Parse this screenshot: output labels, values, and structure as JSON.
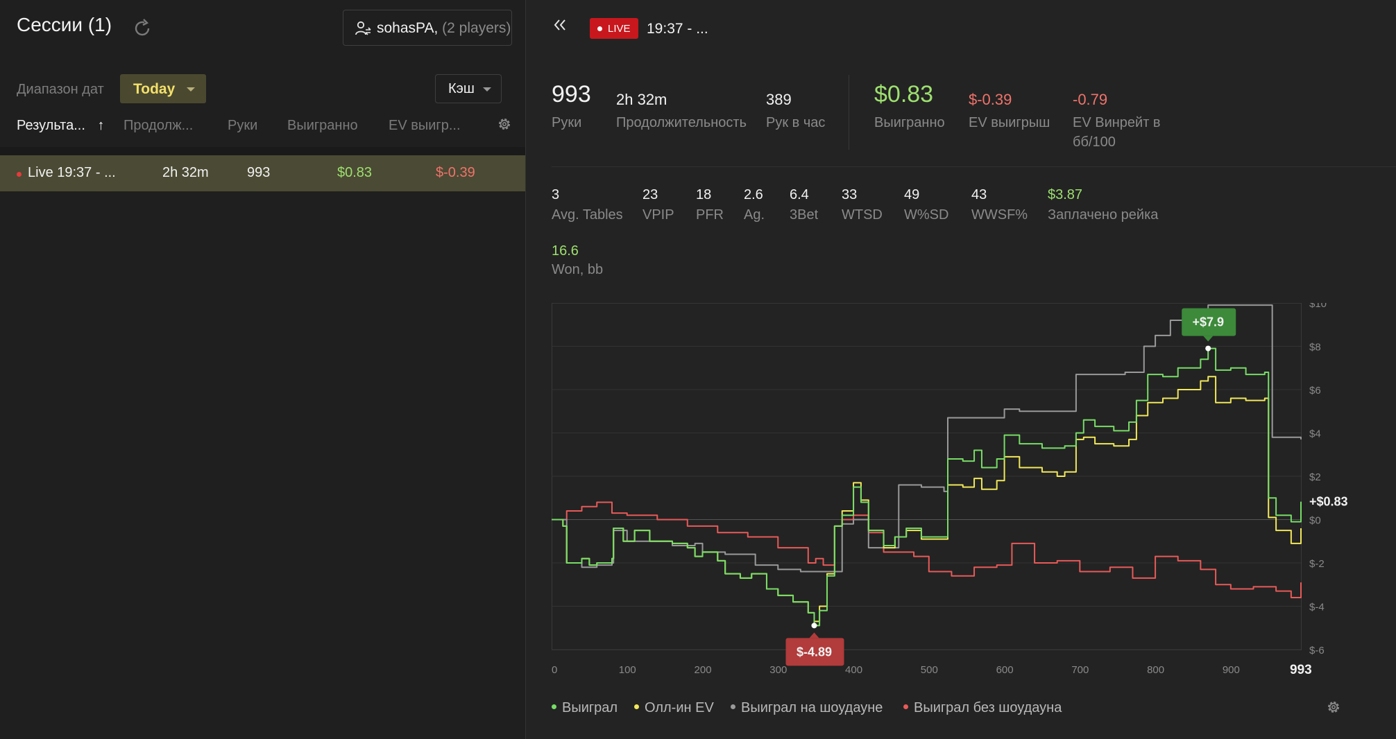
{
  "sessions": {
    "title": "Сессии (1)",
    "player_button": {
      "name": "sohasPA",
      "count": "(2 players)"
    },
    "date_range_label": "Диапазон дат",
    "date_range_value": "Today",
    "game_type": "Кэш",
    "columns": [
      "Результа...",
      "Продолж...",
      "Руки",
      "Выигранно",
      "EV выигр..."
    ],
    "sort_arrow": "↑",
    "rows": [
      {
        "name": "Live 19:37 - ...",
        "duration": "2h 32m",
        "hands": "993",
        "won": "$0.83",
        "ev_won": "$-0.39"
      }
    ]
  },
  "detail": {
    "live_badge": "LIVE",
    "session_title": "19:37 - ...",
    "top_stats": [
      {
        "value": "993",
        "label": "Руки"
      },
      {
        "value": "2h 32m",
        "label": "Продолжительность"
      },
      {
        "value": "389",
        "label": "Рук в час"
      },
      {
        "value": "$0.83",
        "label": "Выигранно"
      },
      {
        "value": "$-0.39",
        "label": "EV выигрыш"
      },
      {
        "value": "-0.79",
        "label": "EV Винрейт в",
        "label2": "бб/100"
      }
    ],
    "stats": [
      {
        "value": "3",
        "label": "Avg. Tables"
      },
      {
        "value": "23",
        "label": "VPIP"
      },
      {
        "value": "18",
        "label": "PFR"
      },
      {
        "value": "2.6",
        "label": "Ag."
      },
      {
        "value": "6.4",
        "label": "3Bet"
      },
      {
        "value": "33",
        "label": "WTSD"
      },
      {
        "value": "49",
        "label": "W%SD"
      },
      {
        "value": "43",
        "label": "WWSF%"
      },
      {
        "value": "$3.87",
        "label": "Заплачено рейка"
      }
    ],
    "won_bb": {
      "value": "16.6",
      "label": "Won, bb"
    },
    "colors": {
      "won": "#77dd66",
      "ev": "#f1e85a",
      "showdown": "#9a9a9a",
      "non_showdown": "#e85a58",
      "positive": "#9de06f",
      "negative": "#f0736b"
    }
  },
  "chart_data": {
    "type": "line",
    "x_label_min": "0",
    "x_ticks": [
      0,
      100,
      200,
      300,
      400,
      500,
      600,
      700,
      800,
      900
    ],
    "x_end_label": "993",
    "xlim": [
      0,
      993
    ],
    "y_ticks": [
      "$10",
      "$8",
      "$6",
      "$4",
      "$2",
      "$0",
      "$-2",
      "$-4",
      "$-6"
    ],
    "y_tick_values": [
      10,
      8,
      6,
      4,
      2,
      0,
      -2,
      -4,
      -6
    ],
    "ylim": [
      -6,
      10
    ],
    "end_value_label": "+$0.83",
    "max_annotation": {
      "label": "+$7.9",
      "x": 870,
      "y": 7.9
    },
    "min_annotation": {
      "label": "$-4.89",
      "x": 348,
      "y": -4.89
    },
    "series": [
      {
        "name": "Выиграл",
        "color": "#77dd66",
        "points": [
          [
            0,
            0
          ],
          [
            15,
            -0.3
          ],
          [
            20,
            -2
          ],
          [
            40,
            -1.8
          ],
          [
            50,
            -2.1
          ],
          [
            60,
            -2
          ],
          [
            80,
            -1.8
          ],
          [
            82,
            -0.4
          ],
          [
            95,
            -1
          ],
          [
            110,
            -0.5
          ],
          [
            130,
            -1
          ],
          [
            160,
            -1.1
          ],
          [
            180,
            -1.3
          ],
          [
            190,
            -1.7
          ],
          [
            200,
            -1.5
          ],
          [
            220,
            -1.9
          ],
          [
            230,
            -2.5
          ],
          [
            250,
            -2.7
          ],
          [
            265,
            -2.5
          ],
          [
            285,
            -3.2
          ],
          [
            300,
            -3.5
          ],
          [
            320,
            -3.8
          ],
          [
            340,
            -4.3
          ],
          [
            348,
            -4.89
          ],
          [
            355,
            -4.2
          ],
          [
            365,
            -2.6
          ],
          [
            375,
            -0.3
          ],
          [
            385,
            0.2
          ],
          [
            400,
            1.5
          ],
          [
            410,
            0.8
          ],
          [
            420,
            -0.5
          ],
          [
            440,
            -1.2
          ],
          [
            455,
            -0.8
          ],
          [
            470,
            -0.4
          ],
          [
            490,
            -0.8
          ],
          [
            520,
            -0.8
          ],
          [
            525,
            2.8
          ],
          [
            545,
            2.7
          ],
          [
            560,
            3.2
          ],
          [
            570,
            2.4
          ],
          [
            590,
            2.8
          ],
          [
            600,
            3.9
          ],
          [
            620,
            3.5
          ],
          [
            650,
            3.3
          ],
          [
            670,
            3.3
          ],
          [
            680,
            3.4
          ],
          [
            695,
            4.0
          ],
          [
            705,
            4.6
          ],
          [
            720,
            4.3
          ],
          [
            745,
            4.1
          ],
          [
            765,
            4.5
          ],
          [
            775,
            5.5
          ],
          [
            790,
            6.7
          ],
          [
            810,
            6.6
          ],
          [
            830,
            7.0
          ],
          [
            860,
            7.4
          ],
          [
            870,
            7.9
          ],
          [
            880,
            6.9
          ],
          [
            900,
            7.0
          ],
          [
            920,
            6.7
          ],
          [
            945,
            6.8
          ],
          [
            950,
            1
          ],
          [
            960,
            0.2
          ],
          [
            980,
            -0.1
          ],
          [
            993,
            0.83
          ]
        ]
      },
      {
        "name": "Олл-ин EV",
        "color": "#f1e85a",
        "points": [
          [
            0,
            0
          ],
          [
            15,
            -0.3
          ],
          [
            20,
            -2
          ],
          [
            40,
            -1.8
          ],
          [
            50,
            -2.1
          ],
          [
            60,
            -2
          ],
          [
            80,
            -1.8
          ],
          [
            82,
            -0.4
          ],
          [
            95,
            -1
          ],
          [
            110,
            -0.5
          ],
          [
            130,
            -1
          ],
          [
            160,
            -1.1
          ],
          [
            180,
            -1.3
          ],
          [
            190,
            -1.7
          ],
          [
            200,
            -1.5
          ],
          [
            220,
            -1.9
          ],
          [
            230,
            -2.5
          ],
          [
            250,
            -2.7
          ],
          [
            265,
            -2.5
          ],
          [
            285,
            -3.2
          ],
          [
            300,
            -3.5
          ],
          [
            320,
            -3.8
          ],
          [
            340,
            -4.3
          ],
          [
            348,
            -4.7
          ],
          [
            355,
            -4.0
          ],
          [
            365,
            -2.5
          ],
          [
            375,
            -0.3
          ],
          [
            385,
            0.4
          ],
          [
            400,
            1.7
          ],
          [
            410,
            0.9
          ],
          [
            420,
            -0.5
          ],
          [
            440,
            -1.3
          ],
          [
            455,
            -0.8
          ],
          [
            470,
            -0.5
          ],
          [
            490,
            -0.9
          ],
          [
            520,
            -0.9
          ],
          [
            525,
            1.6
          ],
          [
            545,
            1.5
          ],
          [
            560,
            1.9
          ],
          [
            570,
            1.4
          ],
          [
            590,
            1.8
          ],
          [
            600,
            2.9
          ],
          [
            620,
            2.4
          ],
          [
            650,
            2.2
          ],
          [
            670,
            2.0
          ],
          [
            680,
            2.2
          ],
          [
            695,
            3.7
          ],
          [
            705,
            3.8
          ],
          [
            720,
            3.5
          ],
          [
            745,
            3.4
          ],
          [
            765,
            3.7
          ],
          [
            775,
            4.8
          ],
          [
            790,
            5.4
          ],
          [
            810,
            5.6
          ],
          [
            830,
            6.0
          ],
          [
            860,
            6.4
          ],
          [
            870,
            6.6
          ],
          [
            880,
            5.4
          ],
          [
            900,
            5.6
          ],
          [
            920,
            5.5
          ],
          [
            945,
            5.6
          ],
          [
            950,
            0.1
          ],
          [
            960,
            -0.5
          ],
          [
            980,
            -1.1
          ],
          [
            993,
            -0.4
          ]
        ]
      },
      {
        "name": "Выиграл на шоудауне",
        "color": "#9a9a9a",
        "points": [
          [
            0,
            0
          ],
          [
            15,
            0
          ],
          [
            20,
            -2
          ],
          [
            40,
            -2.2
          ],
          [
            60,
            -2.1
          ],
          [
            80,
            -2
          ],
          [
            82,
            -0.5
          ],
          [
            100,
            -1
          ],
          [
            130,
            -1
          ],
          [
            160,
            -1.2
          ],
          [
            190,
            -1.1
          ],
          [
            200,
            -1.5
          ],
          [
            230,
            -1.6
          ],
          [
            270,
            -2.1
          ],
          [
            300,
            -2.3
          ],
          [
            330,
            -2.4
          ],
          [
            360,
            -2.4
          ],
          [
            375,
            -2.4
          ],
          [
            385,
            -0.2
          ],
          [
            400,
            0
          ],
          [
            420,
            -1.3
          ],
          [
            460,
            1.6
          ],
          [
            490,
            1.5
          ],
          [
            520,
            1.3
          ],
          [
            525,
            4.7
          ],
          [
            560,
            4.7
          ],
          [
            600,
            5.1
          ],
          [
            620,
            5.0
          ],
          [
            680,
            5.0
          ],
          [
            695,
            6.7
          ],
          [
            720,
            6.7
          ],
          [
            760,
            6.8
          ],
          [
            785,
            8.0
          ],
          [
            800,
            8.5
          ],
          [
            820,
            9.2
          ],
          [
            845,
            9.4
          ],
          [
            870,
            9.9
          ],
          [
            900,
            9.9
          ],
          [
            950,
            9.9
          ],
          [
            955,
            3.8
          ],
          [
            993,
            3.7
          ]
        ]
      },
      {
        "name": "Выиграл без шоудауна",
        "color": "#e85a58",
        "points": [
          [
            0,
            0
          ],
          [
            20,
            0.4
          ],
          [
            40,
            0.6
          ],
          [
            60,
            0.8
          ],
          [
            80,
            0.3
          ],
          [
            100,
            0.2
          ],
          [
            140,
            0
          ],
          [
            180,
            -0.3
          ],
          [
            220,
            -0.6
          ],
          [
            260,
            -0.8
          ],
          [
            300,
            -1.3
          ],
          [
            340,
            -2.0
          ],
          [
            350,
            -1.8
          ],
          [
            360,
            -2.1
          ],
          [
            375,
            -0.3
          ],
          [
            385,
            0.0
          ],
          [
            400,
            0.2
          ],
          [
            420,
            -0.6
          ],
          [
            440,
            -1.5
          ],
          [
            480,
            -1.7
          ],
          [
            500,
            -2.4
          ],
          [
            530,
            -2.6
          ],
          [
            560,
            -2.2
          ],
          [
            590,
            -2.1
          ],
          [
            610,
            -1.1
          ],
          [
            640,
            -2.0
          ],
          [
            670,
            -1.9
          ],
          [
            700,
            -2.4
          ],
          [
            740,
            -2.2
          ],
          [
            770,
            -2.7
          ],
          [
            800,
            -1.7
          ],
          [
            830,
            -1.9
          ],
          [
            860,
            -2.3
          ],
          [
            880,
            -3.0
          ],
          [
            900,
            -3.2
          ],
          [
            930,
            -3.1
          ],
          [
            960,
            -3.3
          ],
          [
            980,
            -3.6
          ],
          [
            993,
            -2.9
          ]
        ]
      }
    ]
  }
}
